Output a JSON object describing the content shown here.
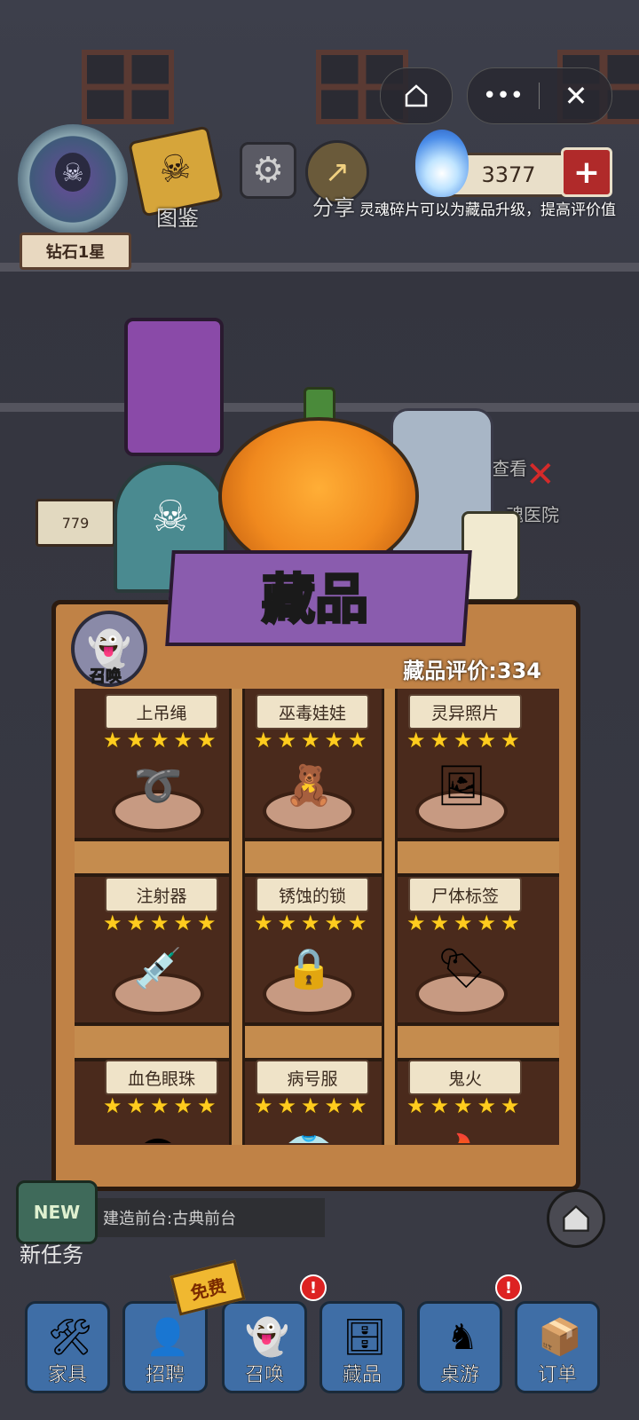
{
  "header": {
    "rank_label": "钻石1星",
    "atlas_label": "图鉴",
    "share_label": "分享",
    "soul_count": "3377",
    "hint": "灵魂碎片可以为藏品升级，提高评价值"
  },
  "scene": {
    "room_number": "779",
    "check_label": "查看",
    "hospital_label": "魂医院"
  },
  "collection": {
    "title": "藏品",
    "rating_label": "藏品评价:334",
    "summon_label": "召唤",
    "items": [
      {
        "name": "上吊绳",
        "stars": 5,
        "icon": "rope-icon"
      },
      {
        "name": "巫毒娃娃",
        "stars": 5,
        "icon": "voodoo-doll-icon"
      },
      {
        "name": "灵异照片",
        "stars": 5,
        "icon": "ghost-photo-icon"
      },
      {
        "name": "注射器",
        "stars": 5,
        "icon": "syringe-icon"
      },
      {
        "name": "锈蚀的锁",
        "stars": 5,
        "icon": "padlock-icon"
      },
      {
        "name": "尸体标签",
        "stars": 5,
        "icon": "toe-tag-icon"
      },
      {
        "name": "血色眼珠",
        "stars": 5,
        "icon": "eyeball-icon"
      },
      {
        "name": "病号服",
        "stars": 5,
        "icon": "gown-icon"
      },
      {
        "name": "鬼火",
        "stars": 5,
        "icon": "ghost-fire-icon"
      }
    ]
  },
  "task": {
    "new_badge": "NEW",
    "label": "新任务",
    "text": "建造前台:古典前台"
  },
  "nav": {
    "free_badge": "免费",
    "items": [
      {
        "label": "家具",
        "icon": "furniture-icon"
      },
      {
        "label": "招聘",
        "icon": "recruit-icon"
      },
      {
        "label": "召唤",
        "icon": "summon-ghost-icon"
      },
      {
        "label": "藏品",
        "icon": "safe-icon"
      },
      {
        "label": "桌游",
        "icon": "chess-board-icon"
      },
      {
        "label": "订单",
        "icon": "order-box-icon"
      }
    ]
  },
  "colors": {
    "accent_purple": "#8a5cae",
    "star": "#ffcc1e",
    "nav_blue": "#3f6ea6",
    "wood": "#c08246"
  }
}
